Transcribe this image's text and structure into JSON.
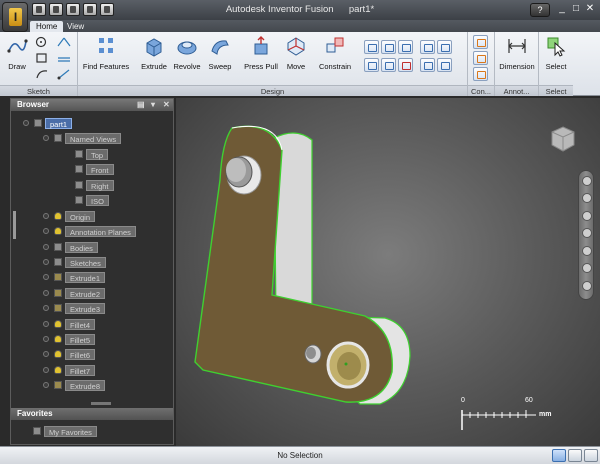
{
  "app": {
    "title": "Autodesk Inventor Fusion",
    "document": "part1*",
    "app_button_glyph": "I",
    "help_label": "?",
    "window_controls": [
      "_",
      "□",
      "✕"
    ]
  },
  "quick_access": [
    "new-icon",
    "open-icon",
    "save-icon",
    "undo-icon",
    "redo-icon"
  ],
  "tabs": [
    {
      "label": "Home",
      "active": true
    },
    {
      "label": "View",
      "active": false
    }
  ],
  "ribbon": {
    "sketch_panel": {
      "label": "Sketch",
      "draw_label": "Draw"
    },
    "design_panel": {
      "label": "Design",
      "buttons": [
        "Find Features",
        "Extrude",
        "Revolve",
        "Sweep",
        "Press Pull",
        "Move",
        "Constrain"
      ]
    },
    "con_panel": {
      "label": "Con..."
    },
    "annot_panel": {
      "label": "Annot...",
      "button": "Dimension"
    },
    "select_panel": {
      "label": "Select",
      "button": "Select"
    }
  },
  "browser": {
    "title": "Browser",
    "items": [
      {
        "label": "part1",
        "icon": "part-icon",
        "selected": true
      },
      {
        "label": "Named Views",
        "icon": "folder-icon"
      },
      {
        "label": "Top",
        "icon": "view-icon"
      },
      {
        "label": "Front",
        "icon": "view-icon"
      },
      {
        "label": "Right",
        "icon": "view-icon"
      },
      {
        "label": "ISO",
        "icon": "view-icon"
      },
      {
        "label": "Origin",
        "icon": "bulb-icon"
      },
      {
        "label": "Annotation Planes",
        "icon": "bulb-icon"
      },
      {
        "label": "Bodies",
        "icon": "folder-icon"
      },
      {
        "label": "Sketches",
        "icon": "folder-icon"
      },
      {
        "label": "Extrude1",
        "icon": "feature-icon"
      },
      {
        "label": "Extrude2",
        "icon": "feature-icon"
      },
      {
        "label": "Extrude3",
        "icon": "feature-icon"
      },
      {
        "label": "Fillet4",
        "icon": "feature-icon"
      },
      {
        "label": "Fillet5",
        "icon": "feature-icon"
      },
      {
        "label": "Fillet6",
        "icon": "feature-icon"
      },
      {
        "label": "Fillet7",
        "icon": "feature-icon"
      },
      {
        "label": "Extrude8",
        "icon": "feature-icon"
      }
    ],
    "favorites_title": "Favorites",
    "favorites": [
      {
        "label": "My Favorites",
        "icon": "favorites-icon"
      }
    ]
  },
  "viewport": {
    "ruler": {
      "start": "0",
      "end": "60",
      "unit": "mm"
    },
    "part_face_color": "#6f5a36",
    "edge_highlight_color": "#3fd030"
  },
  "status": {
    "text": "No Selection"
  }
}
